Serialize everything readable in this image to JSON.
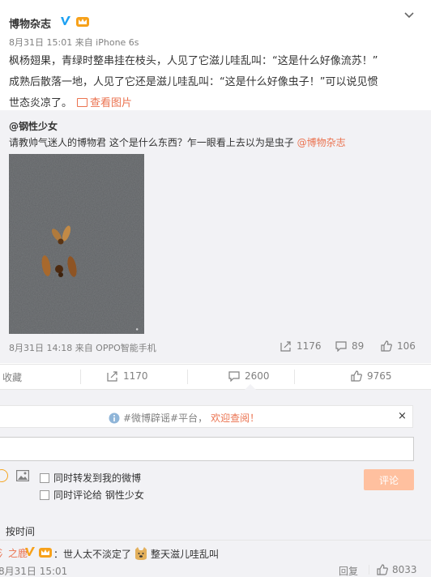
{
  "post": {
    "author": "博物杂志",
    "meta": "8月31日 15:01 来自 iPhone 6s",
    "text_line1": "枫杨翅果，青绿时整串挂在枝头，人见了它滋儿哇乱叫：“这是什么好像流苏！”",
    "text_line2": "成熟后散落一地，人见了它还是滋儿哇乱叫：“这是什么好像虫子！”可以说见惯",
    "text_line3": "世态炎凉了。",
    "view_pic": "查看图片"
  },
  "retweet": {
    "author": "@钢性少女",
    "text": "请教帅气迷人的博物君 这个是什么东西？乍一眼看上去以为是虫子 ",
    "mention": "@博物杂志",
    "meta": "8月31日 14:18 来自 OPPO智能手机",
    "forward_count": "1176",
    "comment_count": "89",
    "like_count": "106"
  },
  "actions": {
    "favorite": "收藏",
    "forward": "1170",
    "comment": "2600",
    "like": "9765"
  },
  "comment_box": {
    "notice_prefix": "#微博辟谣#平台，",
    "notice_link": "欢迎查阅！",
    "close": "×",
    "option_forward": "同时转发到我的微博",
    "option_comment": "同时评论给 钢性少女",
    "submit": "评论"
  },
  "comments": {
    "sort_label": "按时间",
    "items": [
      {
        "name": "氵之鹿",
        "text_a": "：世人太不淡定了",
        "text_b": "整天滋儿哇乱叫",
        "time": "8月31日 15:01",
        "reply": "回复",
        "likes": "8033"
      }
    ]
  },
  "colors": {
    "accent": "#eb7350",
    "verified": "#1da1f2",
    "vip": "#f7a11a",
    "panel": "#f2f2f5"
  }
}
